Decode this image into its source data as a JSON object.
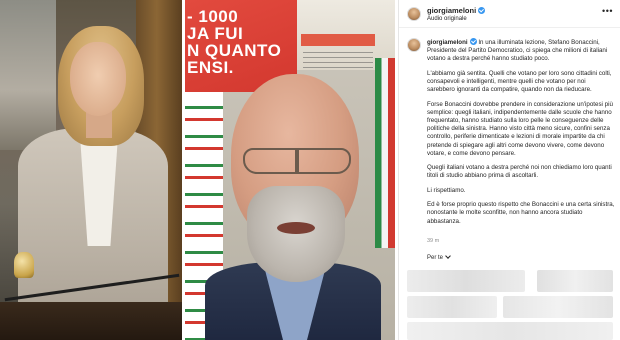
{
  "post": {
    "username": "giorgiameloni",
    "audio_label": "Audio originale",
    "more_icon": "more-horizontal-icon",
    "verified_icon": "verified-badge-icon",
    "caption_paragraphs": [
      "In una illuminata lezione, Stefano Bonaccini, Presidente del Partito Democratico, ci spiega che milioni di italiani votano a destra perché hanno studiato poco.",
      "L'abbiamo già sentita. Quelli che votano per loro sono cittadini colti, consapevoli e intelligenti, mentre quelli che votano per noi sarebbero ignoranti da compatire, quando non da rieducare.",
      "Forse Bonaccini dovrebbe prendere in considerazione un'ipotesi più semplice: quegli italiani, indipendentemente dalle scuole che hanno frequentato, hanno studiato sulla loro pelle le conseguenze delle politiche della sinistra. Hanno visto città meno sicure, confini senza controllo, periferie dimenticate e lezioni di morale impartite da chi pretende di spiegare agli altri come devono vivere, come devono votare, e come devono pensare.",
      "Quegli italiani votano a destra perché noi non chiediamo loro quanti titoli di studio abbiano prima di ascoltarli.",
      "Li rispettiamo.",
      "Ed è forse proprio questo rispetto che Bonaccini e una certa sinistra, nonostante le molte sconfitte, non hanno ancora studiato abbastanza."
    ],
    "time_ago": "39 m",
    "comments_label": "Per te"
  },
  "photo_mid": {
    "banner_lines": [
      "- 1000",
      "JA FUI",
      "N QUANTO",
      "ENSI."
    ]
  },
  "colors": {
    "text": "#262626",
    "muted": "#8e8e8e",
    "verified": "#3897f0",
    "pd_red": "#d3382f",
    "pd_green": "#2f8b45"
  }
}
